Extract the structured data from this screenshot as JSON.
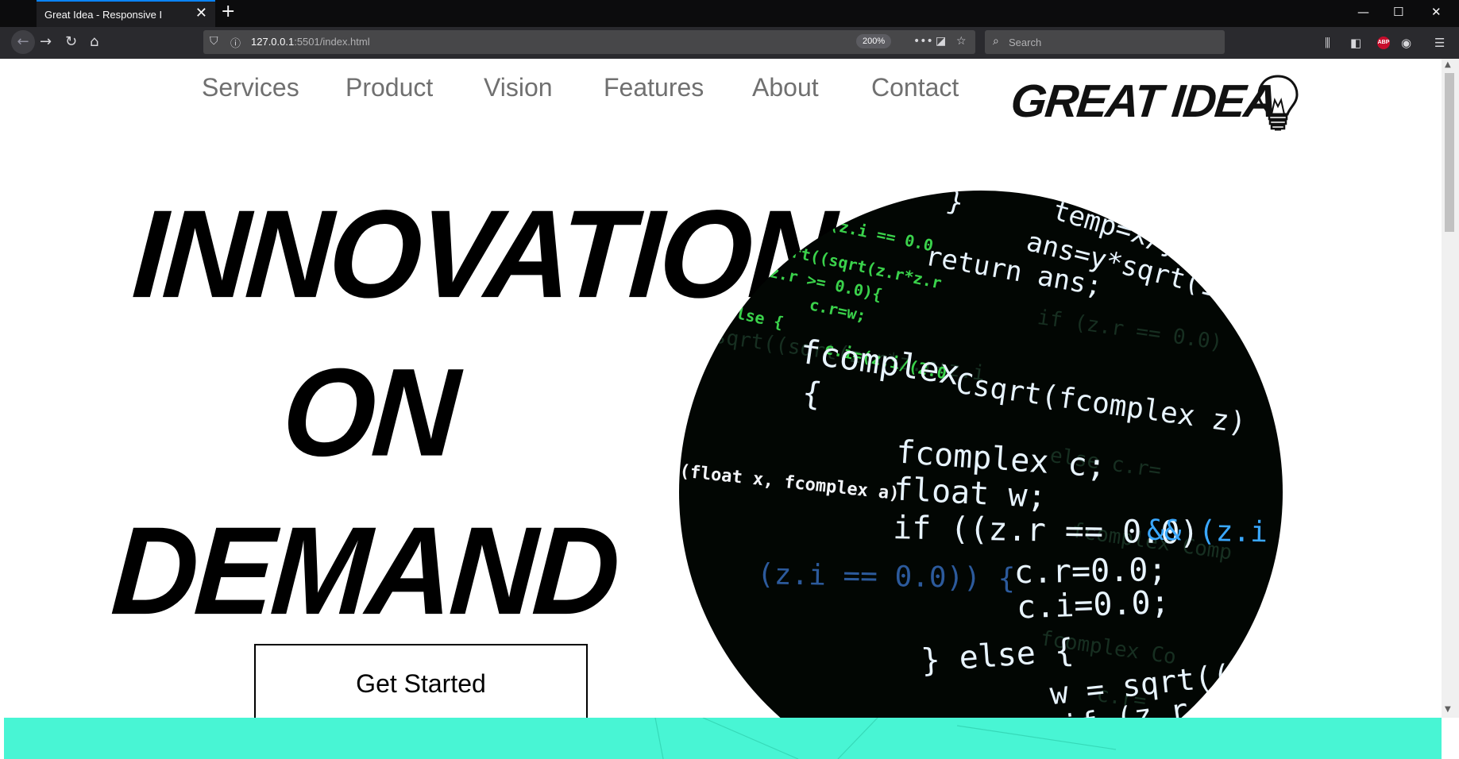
{
  "browser": {
    "tab_title": "Great Idea - Responsive I",
    "tab_close": "✕",
    "new_tab": "+",
    "url_host": "127.0.0.1",
    "url_rest": ":5501/index.html",
    "zoom": "200%",
    "search_placeholder": "Search",
    "more": "•••",
    "abp": "ABP",
    "win_minimize": "—",
    "win_maximize": "☐",
    "win_close": "✕",
    "menu": "☰"
  },
  "site": {
    "nav": [
      "Services",
      "Product",
      "Vision",
      "Features",
      "About",
      "Contact"
    ],
    "logo": "GREAT IDEA",
    "hero_lines": [
      "INNOVATION",
      "ON",
      "DEMAND"
    ],
    "cta": "Get Started"
  },
  "colors": {
    "accent_band": "#48f5d4",
    "code_green": "#3ad24b",
    "code_white": "#e8f4ff",
    "code_blue": "#3aa8ff"
  }
}
